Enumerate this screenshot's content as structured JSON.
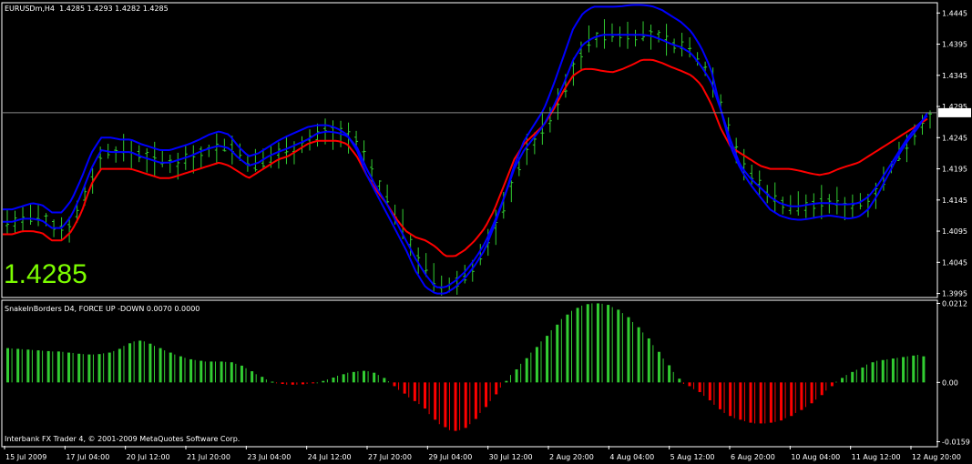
{
  "chart_data": [
    {
      "type": "ohlc",
      "symbol_title": "EURUSDm,H4",
      "ohlc_header": "1.4285 1.4293 1.4282 1.4285",
      "current_price_big": "1.4285",
      "current_price_tag": "1.4285",
      "y_ticks": [
        "1.4445",
        "1.4395",
        "1.4345",
        "1.4295",
        "1.4245",
        "1.4195",
        "1.4145",
        "1.4095",
        "1.4045",
        "1.3995"
      ],
      "ylim": [
        1.399,
        1.446
      ],
      "colors": {
        "bars": "#32CD32",
        "blue": "#0000FF",
        "red": "#FF0000",
        "grid_line": "#8a8a8a"
      },
      "bars_count": 120,
      "center_line": [
        1.411,
        1.411,
        1.4115,
        1.4115,
        1.4112,
        1.41,
        1.41,
        1.412,
        1.4155,
        1.4195,
        1.4225,
        1.4222,
        1.4222,
        1.4222,
        1.4215,
        1.421,
        1.4205,
        1.4205,
        1.421,
        1.4215,
        1.4222,
        1.4228,
        1.4232,
        1.4228,
        1.4212,
        1.42,
        1.4205,
        1.4215,
        1.4222,
        1.4228,
        1.4235,
        1.4242,
        1.4252,
        1.4255,
        1.4253,
        1.4248,
        1.423,
        1.4195,
        1.4165,
        1.414,
        1.411,
        1.408,
        1.405,
        1.4025,
        1.4005,
        1.4005,
        1.4015,
        1.403,
        1.405,
        1.4075,
        1.411,
        1.415,
        1.4195,
        1.4225,
        1.4245,
        1.4265,
        1.4295,
        1.433,
        1.437,
        1.4395,
        1.4405,
        1.441,
        1.441,
        1.441,
        1.441,
        1.441,
        1.4408,
        1.4402,
        1.4395,
        1.439,
        1.438,
        1.436,
        1.4335,
        1.429,
        1.424,
        1.42,
        1.418,
        1.4165,
        1.415,
        1.414,
        1.4135,
        1.4135,
        1.4138,
        1.414,
        1.414,
        1.4138,
        1.4138,
        1.414,
        1.415,
        1.417,
        1.4195,
        1.422,
        1.4245,
        1.4265,
        1.428
      ],
      "upper_band": [
        1.413,
        1.413,
        1.4135,
        1.414,
        1.4137,
        1.4125,
        1.4125,
        1.4145,
        1.418,
        1.422,
        1.4245,
        1.4245,
        1.4242,
        1.4242,
        1.4235,
        1.423,
        1.4225,
        1.4225,
        1.423,
        1.4235,
        1.4242,
        1.425,
        1.4255,
        1.425,
        1.423,
        1.4215,
        1.422,
        1.423,
        1.424,
        1.4248,
        1.4255,
        1.4262,
        1.4265,
        1.4265,
        1.426,
        1.425,
        1.4225,
        1.4185,
        1.4155,
        1.4125,
        1.4095,
        1.4065,
        1.403,
        1.4005,
        1.3995,
        1.3995,
        1.4005,
        1.402,
        1.404,
        1.4065,
        1.4105,
        1.415,
        1.42,
        1.424,
        1.4265,
        1.429,
        1.433,
        1.4375,
        1.442,
        1.4445,
        1.4455,
        1.4455,
        1.4455,
        1.4456,
        1.4458,
        1.4458,
        1.4456,
        1.445,
        1.444,
        1.443,
        1.4415,
        1.439,
        1.4355,
        1.429,
        1.423,
        1.4195,
        1.417,
        1.415,
        1.413,
        1.412,
        1.4115,
        1.4113,
        1.4115,
        1.4118,
        1.412,
        1.4118,
        1.4115,
        1.4118,
        1.413,
        1.4155,
        1.4185,
        1.4215,
        1.424,
        1.426,
        1.4285
      ],
      "lower_band": [
        1.409,
        1.409,
        1.4095,
        1.4095,
        1.4092,
        1.408,
        1.408,
        1.4095,
        1.4125,
        1.417,
        1.4195,
        1.4195,
        1.4195,
        1.4195,
        1.419,
        1.4185,
        1.418,
        1.418,
        1.4185,
        1.419,
        1.4195,
        1.42,
        1.4205,
        1.42,
        1.419,
        1.418,
        1.419,
        1.42,
        1.421,
        1.4215,
        1.4225,
        1.4235,
        1.424,
        1.424,
        1.424,
        1.4235,
        1.4215,
        1.4185,
        1.416,
        1.414,
        1.4115,
        1.4095,
        1.4085,
        1.408,
        1.407,
        1.4055,
        1.4055,
        1.4065,
        1.408,
        1.41,
        1.413,
        1.417,
        1.421,
        1.4235,
        1.425,
        1.4265,
        1.429,
        1.432,
        1.4345,
        1.4355,
        1.4355,
        1.4352,
        1.435,
        1.4355,
        1.4362,
        1.437,
        1.437,
        1.4365,
        1.4358,
        1.4352,
        1.4345,
        1.433,
        1.43,
        1.426,
        1.423,
        1.422,
        1.421,
        1.42,
        1.4195,
        1.4195,
        1.4195,
        1.4192,
        1.4188,
        1.4185,
        1.4188,
        1.4195,
        1.42,
        1.4205,
        1.4215,
        1.4225,
        1.4235,
        1.4245,
        1.4255,
        1.4265,
        1.4275
      ],
      "x_labels": [
        "15 Jul 2009",
        "17 Jul 04:00",
        "20 Jul 12:00",
        "21 Jul 20:00",
        "23 Jul 04:00",
        "24 Jul 12:00",
        "27 Jul 20:00",
        "29 Jul 04:00",
        "30 Jul 12:00",
        "2 Aug 20:00",
        "4 Aug 04:00",
        "5 Aug 12:00",
        "6 Aug 20:00",
        "10 Aug 04:00",
        "11 Aug 12:00",
        "12 Aug 20:00"
      ]
    },
    {
      "type": "bar",
      "title": "SnakeInBorders D4, FORCE UP -DOWN  0.0070 0.0000",
      "y_ticks": [
        "0.0212",
        "0.00",
        "-0.0159"
      ],
      "ylim": [
        -0.017,
        0.0218
      ],
      "colors": {
        "up": "#32CD32",
        "down": "#FF0000"
      },
      "values": [
        0.0092,
        0.0091,
        0.009,
        0.0089,
        0.0088,
        0.0087,
        0.0086,
        0.0085,
        0.0084,
        0.0083,
        0.0083,
        0.0082,
        0.008,
        0.0079,
        0.0077,
        0.0076,
        0.0075,
        0.0075,
        0.0076,
        0.0078,
        0.008,
        0.0084,
        0.009,
        0.0098,
        0.0105,
        0.011,
        0.0112,
        0.011,
        0.0104,
        0.0098,
        0.0092,
        0.0086,
        0.008,
        0.0075,
        0.007,
        0.0066,
        0.0062,
        0.006,
        0.0058,
        0.0056,
        0.0056,
        0.0056,
        0.0056,
        0.0055,
        0.0054,
        0.005,
        0.0045,
        0.0038,
        0.003,
        0.0022,
        0.0015,
        0.0008,
        0.0002,
        -0.0002,
        -0.0004,
        -0.0006,
        -0.0006,
        -0.0006,
        -0.0005,
        -0.0004,
        -0.0002,
        0.0,
        0.0004,
        0.0008,
        0.0013,
        0.0018,
        0.0022,
        0.0026,
        0.0028,
        0.003,
        0.0031,
        0.003,
        0.0026,
        0.002,
        0.0012,
        0.0003,
        -0.001,
        -0.002,
        -0.003,
        -0.004,
        -0.005,
        -0.0058,
        -0.007,
        -0.0085,
        -0.01,
        -0.0112,
        -0.012,
        -0.0128,
        -0.013,
        -0.0128,
        -0.0122,
        -0.0112,
        -0.0098,
        -0.0082,
        -0.0066,
        -0.005,
        -0.0032,
        -0.0014,
        0.0004,
        0.002,
        0.0035,
        0.005,
        0.0065,
        0.008,
        0.0095,
        0.011,
        0.0125,
        0.014,
        0.0155,
        0.017,
        0.0182,
        0.0192,
        0.02,
        0.0206,
        0.021,
        0.0212,
        0.0212,
        0.0211,
        0.0208,
        0.0202,
        0.0195,
        0.0186,
        0.0175,
        0.0162,
        0.0148,
        0.0134,
        0.0118,
        0.01,
        0.0082,
        0.0064,
        0.0046,
        0.0028,
        0.001,
        -0.0004,
        -0.001,
        -0.0018,
        -0.0026,
        -0.0036,
        -0.0048,
        -0.006,
        -0.0072,
        -0.0082,
        -0.009,
        -0.0096,
        -0.01,
        -0.0104,
        -0.0108,
        -0.011,
        -0.011,
        -0.011,
        -0.0108,
        -0.0106,
        -0.0102,
        -0.0096,
        -0.009,
        -0.0082,
        -0.0074,
        -0.0066,
        -0.0056,
        -0.0046,
        -0.0034,
        -0.0022,
        -0.001,
        0.0002,
        0.0012,
        0.002,
        0.0028,
        0.0034,
        0.004,
        0.0048,
        0.0054,
        0.0058,
        0.006,
        0.0062,
        0.0064,
        0.0066,
        0.0068,
        0.007,
        0.0072,
        0.0074,
        0.007
      ]
    }
  ],
  "footer_copyright": "Interbank FX Trader 4, © 2001-2009 MetaQuotes Software Corp."
}
